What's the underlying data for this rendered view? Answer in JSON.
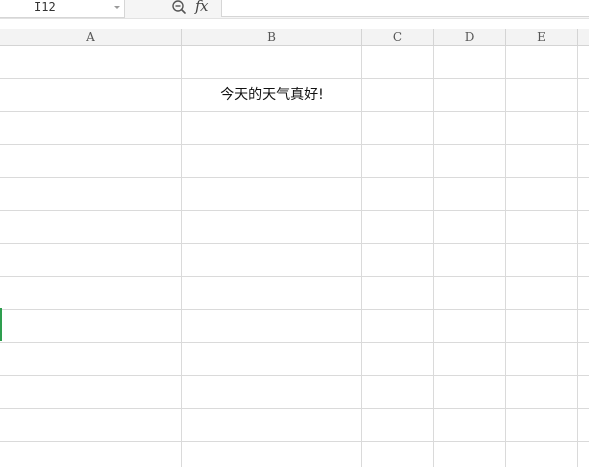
{
  "formula_bar": {
    "name_box": "I12",
    "fx_label": "fx",
    "formula": ""
  },
  "columns": [
    "A",
    "B",
    "C",
    "D",
    "E"
  ],
  "cells": {
    "B2": "今天的天气真好!"
  }
}
